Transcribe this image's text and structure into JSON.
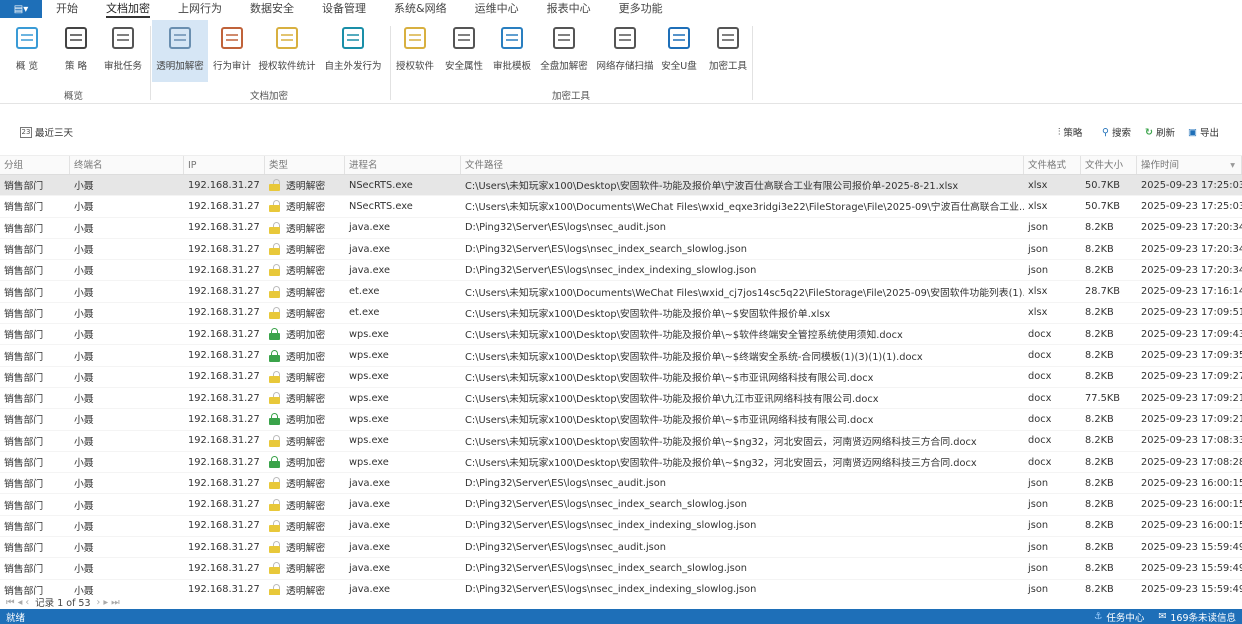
{
  "menu": {
    "app_icon": "app-menu-icon",
    "tabs": [
      "开始",
      "文档加密",
      "上网行为",
      "数据安全",
      "设备管理",
      "系统&网络",
      "运维中心",
      "报表中心",
      "更多功能"
    ],
    "active": 1
  },
  "ribbon": {
    "buttons": [
      {
        "label": "概 览",
        "icon": "overview-grid-icon",
        "color": "#3a9bd6"
      },
      {
        "label": "策 略",
        "icon": "policy-sliders-icon",
        "color": "#444"
      },
      {
        "label": "审批任务",
        "icon": "approval-clipboard-icon",
        "color": "#555"
      },
      {
        "label": "透明加解密",
        "icon": "cube-icon",
        "color": "#6a8fb0",
        "selected": true
      },
      {
        "label": "行为审计",
        "icon": "audit-document-icon",
        "color": "#c0633a"
      },
      {
        "label": "授权软件统计",
        "icon": "software-stats-icon",
        "color": "#d8b040"
      },
      {
        "label": "自主外发行为",
        "icon": "paper-plane-icon",
        "color": "#1a8fa8"
      },
      {
        "label": "授权软件",
        "icon": "authorized-software-icon",
        "color": "#d8b040"
      },
      {
        "label": "安全属性",
        "icon": "security-attribute-icon",
        "color": "#555"
      },
      {
        "label": "审批模板",
        "icon": "approval-template-icon",
        "color": "#2a7fc0"
      },
      {
        "label": "全盘加解密",
        "icon": "disk-encrypt-icon",
        "color": "#555"
      },
      {
        "label": "网络存储扫描",
        "icon": "network-storage-icon",
        "color": "#555"
      },
      {
        "label": "安全U盘",
        "icon": "secure-usb-icon",
        "color": "#1e6fb8"
      },
      {
        "label": "加密工具",
        "icon": "encrypt-toolbox-icon",
        "color": "#555"
      }
    ],
    "groups": [
      "概览",
      "文档加密",
      "加密工具"
    ]
  },
  "toolbar": {
    "range": "最近三天",
    "policy": "策略",
    "search": "搜索",
    "refresh": "刷新",
    "export": "导出"
  },
  "table": {
    "columns": [
      "分组",
      "终端名",
      "IP",
      "类型",
      "进程名",
      "文件路径",
      "文件格式",
      "文件大小",
      "操作时间"
    ],
    "rows": [
      [
        "销售部门",
        "小聂",
        "192.168.31.27",
        "透明解密",
        "NSecRTS.exe",
        "C:\\Users\\未知玩家x100\\Desktop\\安固软件-功能及报价单\\宁波百仕高联合工业有限公司报价单-2025-8-21.xlsx",
        "xlsx",
        "50.7KB",
        "2025-09-23 17:25:03"
      ],
      [
        "销售部门",
        "小聂",
        "192.168.31.27",
        "透明解密",
        "NSecRTS.exe",
        "C:\\Users\\未知玩家x100\\Documents\\WeChat Files\\wxid_eqxe3ridgi3e22\\FileStorage\\File\\2025-09\\宁波百仕高联合工业...",
        "xlsx",
        "50.7KB",
        "2025-09-23 17:25:03"
      ],
      [
        "销售部门",
        "小聂",
        "192.168.31.27",
        "透明解密",
        "java.exe",
        "D:\\Ping32\\Server\\ES\\logs\\nsec_audit.json",
        "json",
        "8.2KB",
        "2025-09-23 17:20:34"
      ],
      [
        "销售部门",
        "小聂",
        "192.168.31.27",
        "透明解密",
        "java.exe",
        "D:\\Ping32\\Server\\ES\\logs\\nsec_index_search_slowlog.json",
        "json",
        "8.2KB",
        "2025-09-23 17:20:34"
      ],
      [
        "销售部门",
        "小聂",
        "192.168.31.27",
        "透明解密",
        "java.exe",
        "D:\\Ping32\\Server\\ES\\logs\\nsec_index_indexing_slowlog.json",
        "json",
        "8.2KB",
        "2025-09-23 17:20:34"
      ],
      [
        "销售部门",
        "小聂",
        "192.168.31.27",
        "透明解密",
        "et.exe",
        "C:\\Users\\未知玩家x100\\Documents\\WeChat Files\\wxid_cj7jos14sc5q22\\FileStorage\\File\\2025-09\\安固软件功能列表(1).x...",
        "xlsx",
        "28.7KB",
        "2025-09-23 17:16:14"
      ],
      [
        "销售部门",
        "小聂",
        "192.168.31.27",
        "透明解密",
        "et.exe",
        "C:\\Users\\未知玩家x100\\Desktop\\安固软件-功能及报价单\\~$安固软件报价单.xlsx",
        "xlsx",
        "8.2KB",
        "2025-09-23 17:09:51"
      ],
      [
        "销售部门",
        "小聂",
        "192.168.31.27",
        "透明加密",
        "wps.exe",
        "C:\\Users\\未知玩家x100\\Desktop\\安固软件-功能及报价单\\~$软件终端安全管控系统使用须知.docx",
        "docx",
        "8.2KB",
        "2025-09-23 17:09:43"
      ],
      [
        "销售部门",
        "小聂",
        "192.168.31.27",
        "透明加密",
        "wps.exe",
        "C:\\Users\\未知玩家x100\\Desktop\\安固软件-功能及报价单\\~$终端安全系统-合同模板(1)(3)(1)(1).docx",
        "docx",
        "8.2KB",
        "2025-09-23 17:09:35"
      ],
      [
        "销售部门",
        "小聂",
        "192.168.31.27",
        "透明解密",
        "wps.exe",
        "C:\\Users\\未知玩家x100\\Desktop\\安固软件-功能及报价单\\~$市亚讯网络科技有限公司.docx",
        "docx",
        "8.2KB",
        "2025-09-23 17:09:27"
      ],
      [
        "销售部门",
        "小聂",
        "192.168.31.27",
        "透明解密",
        "wps.exe",
        "C:\\Users\\未知玩家x100\\Desktop\\安固软件-功能及报价单\\九江市亚讯网络科技有限公司.docx",
        "docx",
        "77.5KB",
        "2025-09-23 17:09:21"
      ],
      [
        "销售部门",
        "小聂",
        "192.168.31.27",
        "透明加密",
        "wps.exe",
        "C:\\Users\\未知玩家x100\\Desktop\\安固软件-功能及报价单\\~$市亚讯网络科技有限公司.docx",
        "docx",
        "8.2KB",
        "2025-09-23 17:09:21"
      ],
      [
        "销售部门",
        "小聂",
        "192.168.31.27",
        "透明解密",
        "wps.exe",
        "C:\\Users\\未知玩家x100\\Desktop\\安固软件-功能及报价单\\~$ng32，河北安固云，河南贤迈网络科技三方合同.docx",
        "docx",
        "8.2KB",
        "2025-09-23 17:08:33"
      ],
      [
        "销售部门",
        "小聂",
        "192.168.31.27",
        "透明加密",
        "wps.exe",
        "C:\\Users\\未知玩家x100\\Desktop\\安固软件-功能及报价单\\~$ng32，河北安固云，河南贤迈网络科技三方合同.docx",
        "docx",
        "8.2KB",
        "2025-09-23 17:08:28"
      ],
      [
        "销售部门",
        "小聂",
        "192.168.31.27",
        "透明解密",
        "java.exe",
        "D:\\Ping32\\Server\\ES\\logs\\nsec_audit.json",
        "json",
        "8.2KB",
        "2025-09-23 16:00:15"
      ],
      [
        "销售部门",
        "小聂",
        "192.168.31.27",
        "透明解密",
        "java.exe",
        "D:\\Ping32\\Server\\ES\\logs\\nsec_index_search_slowlog.json",
        "json",
        "8.2KB",
        "2025-09-23 16:00:15"
      ],
      [
        "销售部门",
        "小聂",
        "192.168.31.27",
        "透明解密",
        "java.exe",
        "D:\\Ping32\\Server\\ES\\logs\\nsec_index_indexing_slowlog.json",
        "json",
        "8.2KB",
        "2025-09-23 16:00:15"
      ],
      [
        "销售部门",
        "小聂",
        "192.168.31.27",
        "透明解密",
        "java.exe",
        "D:\\Ping32\\Server\\ES\\logs\\nsec_audit.json",
        "json",
        "8.2KB",
        "2025-09-23 15:59:49"
      ],
      [
        "销售部门",
        "小聂",
        "192.168.31.27",
        "透明解密",
        "java.exe",
        "D:\\Ping32\\Server\\ES\\logs\\nsec_index_search_slowlog.json",
        "json",
        "8.2KB",
        "2025-09-23 15:59:49"
      ],
      [
        "销售部门",
        "小聂",
        "192.168.31.27",
        "透明解密",
        "java.exe",
        "D:\\Ping32\\Server\\ES\\logs\\nsec_index_indexing_slowlog.json",
        "json",
        "8.2KB",
        "2025-09-23 15:59:49"
      ]
    ],
    "selected_row": 0,
    "lock_colors": {
      "透明解密": "#e8c83a",
      "透明加密": "#3aa34a"
    }
  },
  "pager": {
    "text": "记录 1 of 53"
  },
  "status": {
    "left": "就绪",
    "task_center": "任务中心",
    "messages": "169条未读信息",
    "bar_color": "#1e6fb8"
  }
}
